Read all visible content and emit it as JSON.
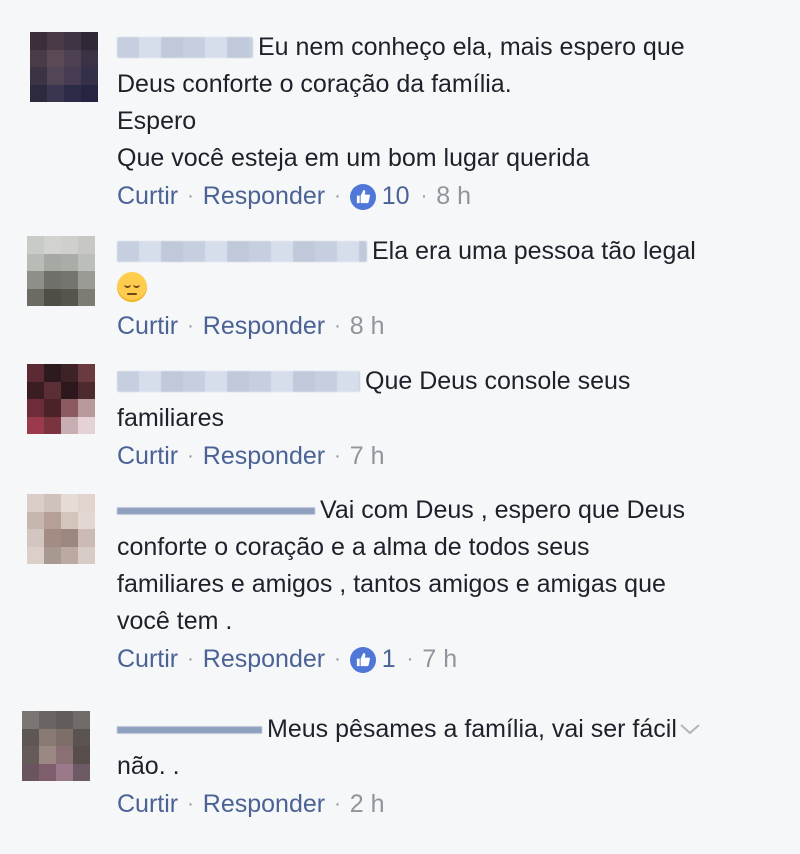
{
  "actions": {
    "like": "Curtir",
    "reply": "Responder",
    "separator": "·"
  },
  "comments": [
    {
      "text": "Eu nem conheço ela, mais espero que",
      "lines": [
        "Deus conforte o coração da família.",
        "Espero",
        "Que você esteja em um bom lugar querida"
      ],
      "reactions": "10",
      "time": "8 h"
    },
    {
      "text": "Ela era uma pessoa tão legal",
      "emoji_icon": "pensive-face-icon",
      "time": "8 h"
    },
    {
      "text": "Que Deus console seus",
      "lines": [
        "familiares"
      ],
      "time": "7 h"
    },
    {
      "text": "Vai com Deus , espero que Deus",
      "lines": [
        "conforte o coração e a alma de todos seus",
        "familiares e amigos , tantos amigos e amigas que",
        "você tem ."
      ],
      "reactions": "1",
      "time": "7 h"
    },
    {
      "text": "Meus pêsames a família, vai ser fácil",
      "lines": [
        "não. ."
      ],
      "time": "2 h"
    }
  ],
  "colors": {
    "link": "#4b6296",
    "meta": "#90949c",
    "like_badge": "#4f77d8",
    "background": "#f6f7f9"
  },
  "icons": {
    "like": "thumbs-up-icon",
    "more": "chevron-down-icon"
  }
}
